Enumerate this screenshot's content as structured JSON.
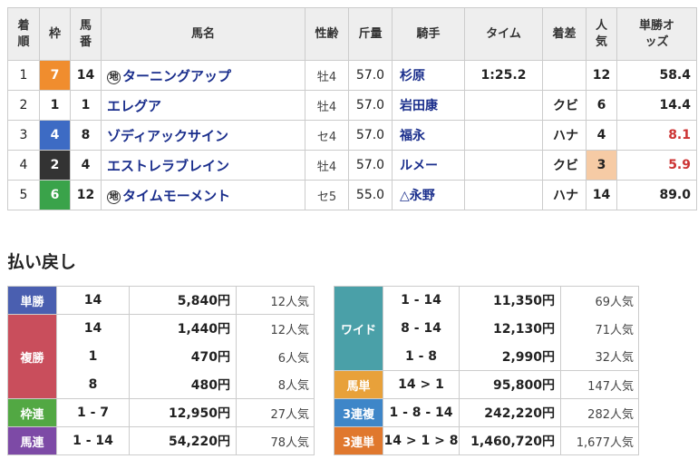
{
  "headers": {
    "rank": "着順",
    "waku": "枠",
    "umaban": "馬番",
    "name": "馬名",
    "sexage": "性齢",
    "weight": "斤量",
    "jockey": "騎手",
    "time": "タイム",
    "margin": "着差",
    "popularity": "人気",
    "odds": "単勝オッズ"
  },
  "chi_mark": "地",
  "rows": [
    {
      "rank": "1",
      "waku": "7",
      "waku_color": "#f08d2e",
      "umaban": "14",
      "chi": true,
      "name": "ターニングアップ",
      "sexage": "牡4",
      "weight": "57.0",
      "jockey": "杉原",
      "time": "1:25.2",
      "margin": "",
      "popularity": "12",
      "odds": "58.4"
    },
    {
      "rank": "2",
      "waku": "1",
      "waku_color": "#ffffff",
      "umaban": "1",
      "chi": false,
      "name": "エレグア",
      "sexage": "牡4",
      "weight": "57.0",
      "jockey": "岩田康",
      "time": "",
      "margin": "クビ",
      "popularity": "6",
      "odds": "14.4"
    },
    {
      "rank": "3",
      "waku": "4",
      "waku_color": "#3d6bc4",
      "umaban": "8",
      "chi": false,
      "name": "ゾディアックサイン",
      "sexage": "セ4",
      "weight": "57.0",
      "jockey": "福永",
      "time": "",
      "margin": "ハナ",
      "popularity": "4",
      "odds": "8.1"
    },
    {
      "rank": "4",
      "waku": "2",
      "waku_color": "#333333",
      "umaban": "4",
      "chi": false,
      "name": "エストレラブレイン",
      "sexage": "牡4",
      "weight": "57.0",
      "jockey": "ルメー",
      "time": "",
      "margin": "クビ",
      "popularity": "3",
      "odds": "5.9"
    },
    {
      "rank": "5",
      "waku": "6",
      "waku_color": "#3aa34a",
      "umaban": "12",
      "chi": true,
      "name": "タイムモーメント",
      "sexage": "セ5",
      "weight": "55.0",
      "jockey": "△永野",
      "time": "",
      "margin": "ハナ",
      "popularity": "14",
      "odds": "89.0"
    }
  ],
  "payout_title": "払い戻し",
  "payouts_left": [
    {
      "label": "単勝",
      "color": "#4a5fb0",
      "entries": [
        {
          "combo": "14",
          "amount": "5,840円",
          "ninki": "12人気"
        }
      ]
    },
    {
      "label": "複勝",
      "color": "#c94e5c",
      "entries": [
        {
          "combo": "14",
          "amount": "1,440円",
          "ninki": "12人気"
        },
        {
          "combo": "1",
          "amount": "470円",
          "ninki": "6人気"
        },
        {
          "combo": "8",
          "amount": "480円",
          "ninki": "8人気"
        }
      ]
    },
    {
      "label": "枠連",
      "color": "#52a843",
      "entries": [
        {
          "combo": "1 - 7",
          "amount": "12,950円",
          "ninki": "27人気"
        }
      ]
    },
    {
      "label": "馬連",
      "color": "#7d4aa6",
      "entries": [
        {
          "combo": "1 - 14",
          "amount": "54,220円",
          "ninki": "78人気"
        }
      ]
    }
  ],
  "payouts_right": [
    {
      "label": "ワイド",
      "color": "#4aa0a8",
      "entries": [
        {
          "combo": "1 - 14",
          "amount": "11,350円",
          "ninki": "69人気"
        },
        {
          "combo": "8 - 14",
          "amount": "12,130円",
          "ninki": "71人気"
        },
        {
          "combo": "1 - 8",
          "amount": "2,990円",
          "ninki": "32人気"
        }
      ]
    },
    {
      "label": "馬単",
      "color": "#e8a13a",
      "entries": [
        {
          "combo": "14 > 1",
          "amount": "95,800円",
          "ninki": "147人気"
        }
      ]
    },
    {
      "label": "3連複",
      "color": "#3e86c8",
      "entries": [
        {
          "combo": "1 - 8 - 14",
          "amount": "242,220円",
          "ninki": "282人気"
        }
      ]
    },
    {
      "label": "3連単",
      "color": "#e0782e",
      "entries": [
        {
          "combo": "14 > 1 > 8",
          "amount": "1,460,720円",
          "ninki": "1,677人気"
        }
      ]
    }
  ]
}
